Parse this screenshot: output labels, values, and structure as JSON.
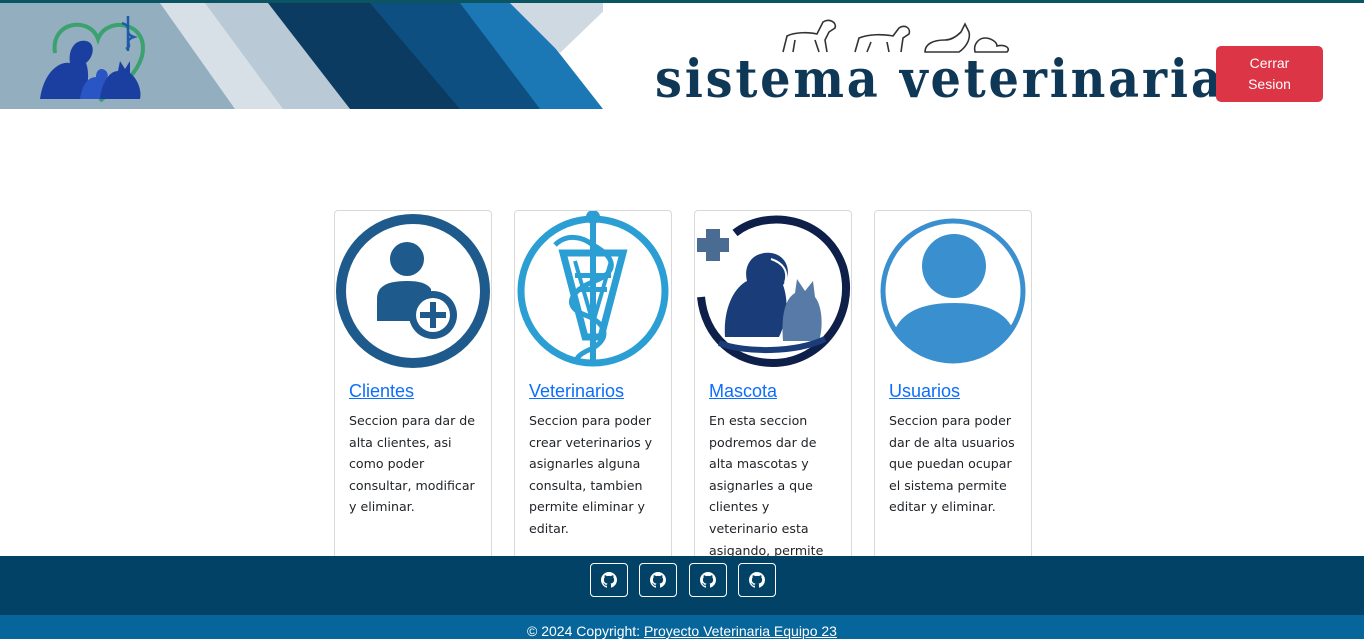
{
  "header": {
    "app_title": "sistema veterinaria",
    "logout_label": "Cerrar\nSesion"
  },
  "cards": [
    {
      "title": "Clientes",
      "text": "Seccion para dar de alta clientes, asi como poder consultar, modificar y eliminar.",
      "icon": "add-user-icon"
    },
    {
      "title": "Veterinarios",
      "text": "Seccion para poder crear veterinarios y asignarles alguna consulta, tambien permite eliminar y editar.",
      "icon": "caduceus-icon"
    },
    {
      "title": "Mascota",
      "text": "En esta seccion podremos dar de alta mascotas y asignarles a que clientes y veterinario esta asigando, permite",
      "icon": "pets-medical-icon"
    },
    {
      "title": "Usuarios",
      "text": "Seccion para poder dar de alta usuarios que puedan ocupar el sistema permite editar y eliminar.",
      "icon": "user-icon"
    }
  ],
  "footer": {
    "social_icons": [
      "github-icon",
      "github-icon",
      "github-icon",
      "github-icon"
    ],
    "copyright_prefix": "© 2024 Copyright:",
    "copyright_link": "Proyecto Veterinaria Equipo 23"
  },
  "colors": {
    "accent_blue": "#0d6efd",
    "danger": "#dc3545",
    "footer_dark": "#034267",
    "footer_light": "#06669c"
  }
}
